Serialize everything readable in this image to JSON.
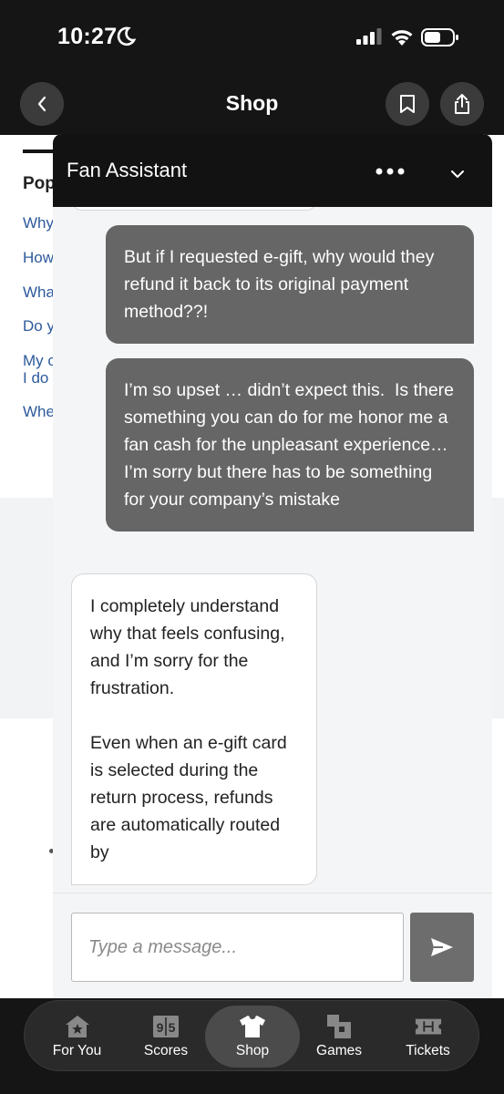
{
  "status_bar": {
    "time": "10:27"
  },
  "nav": {
    "title": "Shop"
  },
  "background": {
    "heading": "Pop",
    "links": [
      "Why",
      "How",
      "Wha",
      "Do y",
      "My c",
      "I do",
      "Whe"
    ]
  },
  "chat": {
    "title": "Fan Assistant",
    "messages": [
      {
        "role": "user",
        "text": "But if I requested e-gift, why would they refund it back to its original payment method??!"
      },
      {
        "role": "user",
        "text": "I’m so upset … didn’t expect this.  Is there something you can do for me honor me a fan cash for the unpleasant experience… I’m sorry but there has to be something for your company’s mistake"
      },
      {
        "role": "assistant",
        "text": "I completely understand why that feels confusing, and I’m sorry for the frustration.\n\nEven when an e-gift card is selected during the return process, refunds are automatically routed by"
      }
    ],
    "input_placeholder": "Type a message..."
  },
  "tabbar": {
    "tabs": [
      {
        "label": "For You",
        "icon": "home-star-icon"
      },
      {
        "label": "Scores",
        "icon": "scoreboard-icon"
      },
      {
        "label": "Shop",
        "icon": "jersey-icon",
        "active": true
      },
      {
        "label": "Games",
        "icon": "puzzle-grid-icon"
      },
      {
        "label": "Tickets",
        "icon": "ticket-icon"
      }
    ]
  },
  "colors": {
    "dark_bg": "#151515",
    "user_bubble": "#666666",
    "link_blue": "#2d5a9c",
    "send_button": "#6d6d6d"
  }
}
